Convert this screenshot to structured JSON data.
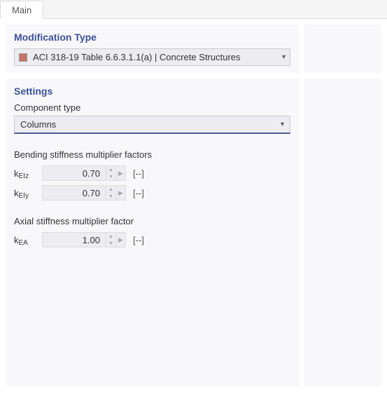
{
  "tabs": {
    "main": "Main"
  },
  "modification": {
    "title": "Modification Type",
    "selected": "ACI 318-19 Table 6.6.3.1.1(a) | Concrete Structures",
    "swatch_color": "#c5736b"
  },
  "settings": {
    "title": "Settings",
    "component_label": "Component type",
    "component_value": "Columns",
    "bending_label": "Bending stiffness multiplier factors",
    "axial_label": "Axial stiffness multiplier factor",
    "params": {
      "kEIz": {
        "key_main": "k",
        "key_sub": "EIz",
        "value": "0.70",
        "unit": "[--]"
      },
      "kEIy": {
        "key_main": "k",
        "key_sub": "EIy",
        "value": "0.70",
        "unit": "[--]"
      },
      "kEA": {
        "key_main": "k",
        "key_sub": "EA",
        "value": "1.00",
        "unit": "[--]"
      }
    }
  }
}
